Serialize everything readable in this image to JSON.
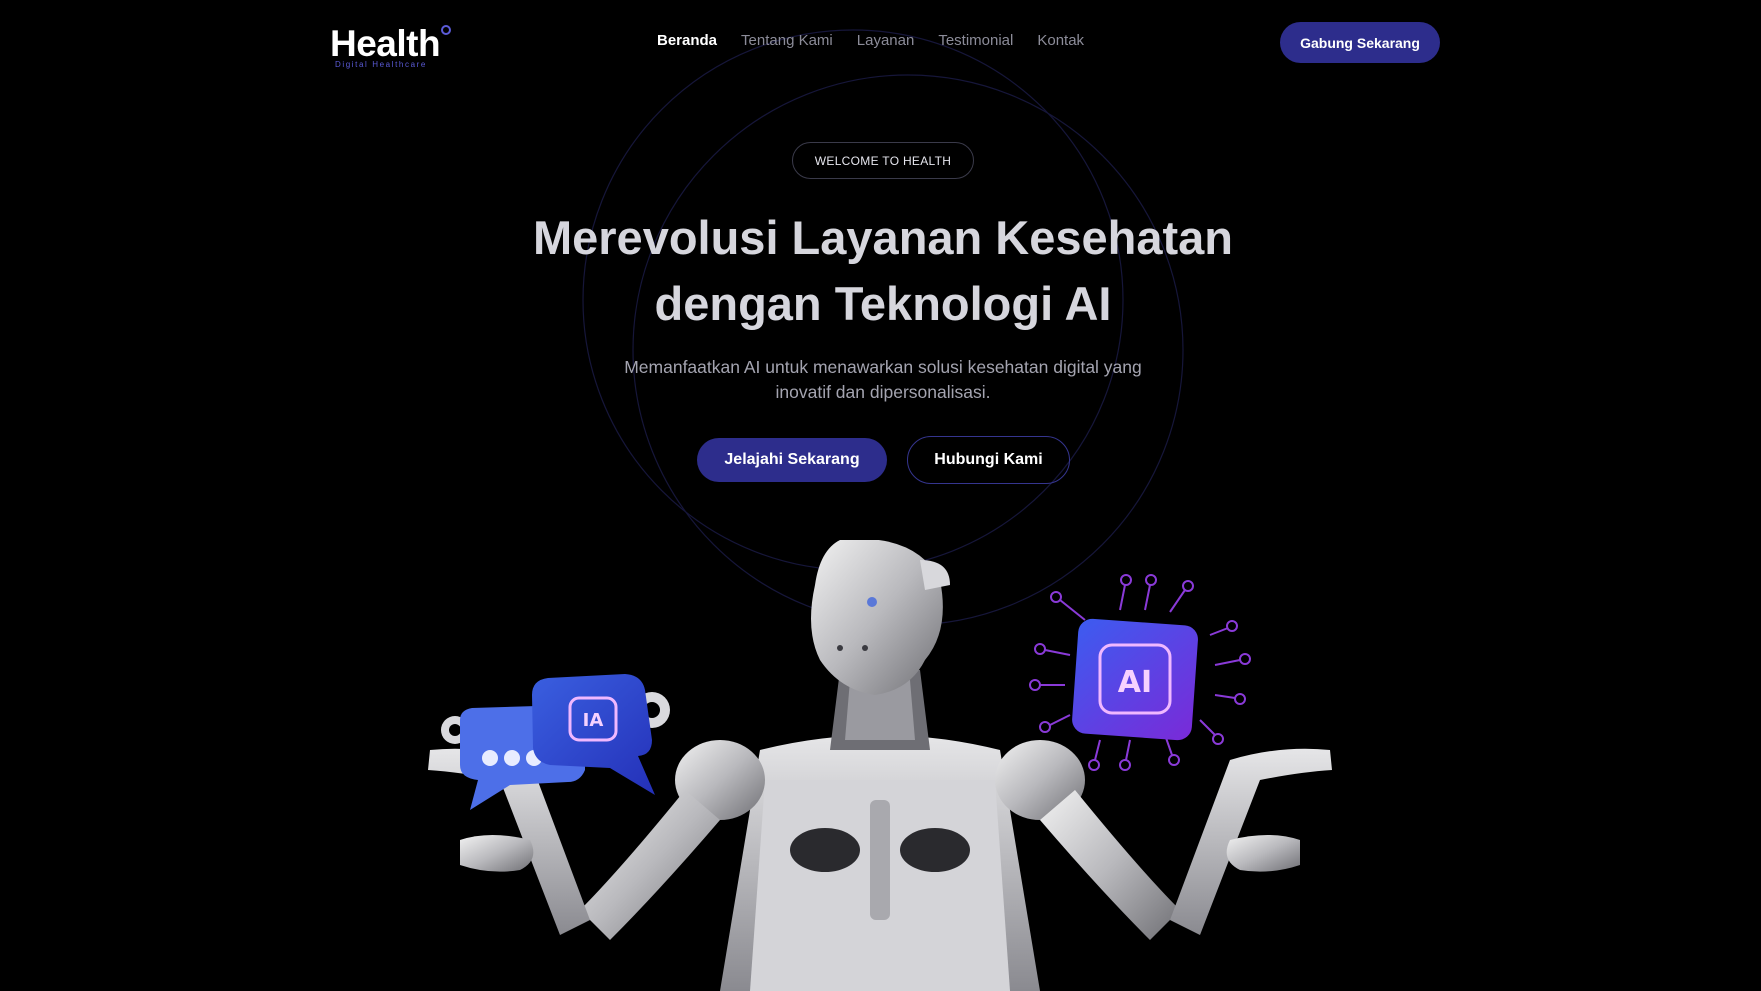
{
  "brand": {
    "name": "Health",
    "tagline": "Digital Healthcare",
    "accent": "#2d2d8c",
    "accent_light": "#5b5bd8"
  },
  "nav": {
    "items": [
      {
        "label": "Beranda",
        "active": true
      },
      {
        "label": "Tentang Kami",
        "active": false
      },
      {
        "label": "Layanan",
        "active": false
      },
      {
        "label": "Testimonial",
        "active": false
      },
      {
        "label": "Kontak",
        "active": false
      }
    ],
    "cta_label": "Gabung Sekarang"
  },
  "hero": {
    "badge": "WELCOME TO HEALTH",
    "title_line1": "Merevolusi Layanan Kesehatan",
    "title_line2": "dengan Teknologi AI",
    "subtitle_line1": "Memanfaatkan AI untuk menawarkan solusi kesehatan digital yang",
    "subtitle_line2": "inovatif dan dipersonalisasi.",
    "primary_button": "Jelajahi Sekarang",
    "secondary_button": "Hubungi Kami"
  },
  "illustration": {
    "chat_bubble_badge": "IA",
    "chip_badge": "AI",
    "icons": [
      "robot-illustration",
      "chat-bubble-icon",
      "ai-chip-icon",
      "gear-icon"
    ]
  },
  "colors": {
    "background": "#000000",
    "text_primary": "#d6d6dd",
    "text_muted": "#a4a4b0",
    "nav_inactive": "#8c8c99"
  }
}
